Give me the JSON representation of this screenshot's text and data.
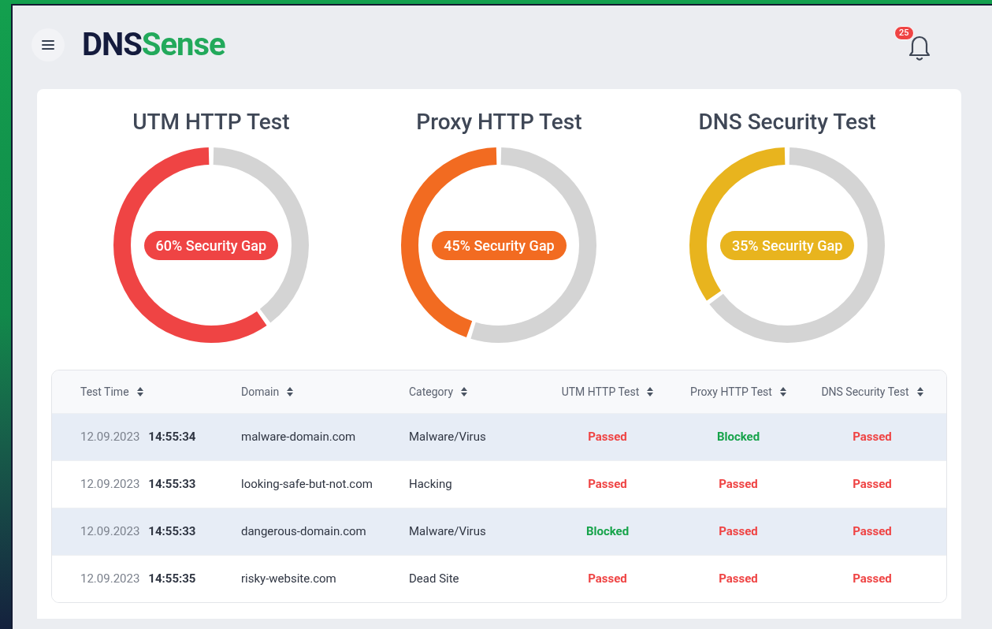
{
  "header": {
    "logo": {
      "part_1": "DNS",
      "part_2": "Sense"
    },
    "notifications": {
      "count": "25"
    }
  },
  "gauges": [
    {
      "title": "UTM HTTP Test",
      "label": "60% Security Gap",
      "color": "#ef4444"
    },
    {
      "title": "Proxy HTTP Test",
      "label": "45% Security Gap",
      "color": "#f26b21"
    },
    {
      "title": "DNS Security Test",
      "label": "35% Security Gap",
      "color": "#e8b41e"
    }
  ],
  "table": {
    "columns": [
      "Test Time",
      "Domain",
      "Category",
      "UTM HTTP Test",
      "Proxy HTTP Test",
      "DNS Security Test"
    ],
    "rows": [
      {
        "date": "12.09.2023",
        "time": "14:55:34",
        "domain": "malware-domain.com",
        "category": "Malware/Virus",
        "results": [
          {
            "text": "Passed",
            "kind": "passed"
          },
          {
            "text": "Blocked",
            "kind": "blocked"
          },
          {
            "text": "Passed",
            "kind": "passed"
          }
        ]
      },
      {
        "date": "12.09.2023",
        "time": "14:55:33",
        "domain": "looking-safe-but-not.com",
        "category": "Hacking",
        "results": [
          {
            "text": "Passed",
            "kind": "passed"
          },
          {
            "text": "Passed",
            "kind": "passed"
          },
          {
            "text": "Passed",
            "kind": "passed"
          }
        ]
      },
      {
        "date": "12.09.2023",
        "time": "14:55:33",
        "domain": "dangerous-domain.com",
        "category": "Malware/Virus",
        "results": [
          {
            "text": "Blocked",
            "kind": "blocked"
          },
          {
            "text": "Passed",
            "kind": "passed"
          },
          {
            "text": "Passed",
            "kind": "passed"
          }
        ]
      },
      {
        "date": "12.09.2023",
        "time": "14:55:35",
        "domain": "risky-website.com",
        "category": "Dead Site",
        "results": [
          {
            "text": "Passed",
            "kind": "passed"
          },
          {
            "text": "Passed",
            "kind": "passed"
          },
          {
            "text": "Passed",
            "kind": "passed"
          }
        ]
      }
    ]
  }
}
